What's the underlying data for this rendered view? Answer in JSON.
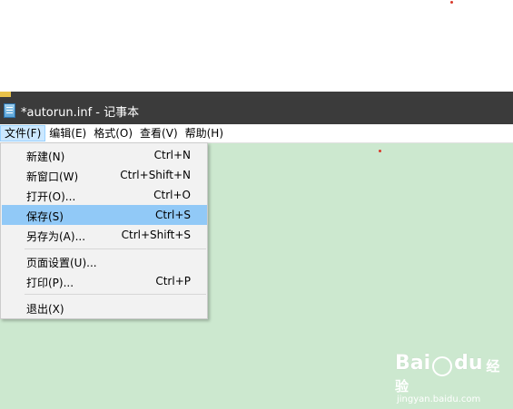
{
  "window": {
    "title": "*autorun.inf - 记事本",
    "icon": "notepad-icon"
  },
  "menubar": [
    {
      "label": "文件(F)",
      "active": true
    },
    {
      "label": "编辑(E)",
      "active": false
    },
    {
      "label": "格式(O)",
      "active": false
    },
    {
      "label": "查看(V)",
      "active": false
    },
    {
      "label": "帮助(H)",
      "active": false
    }
  ],
  "file_menu": {
    "items": [
      {
        "label": "新建(N)",
        "shortcut": "Ctrl+N"
      },
      {
        "label": "新窗口(W)",
        "shortcut": "Ctrl+Shift+N"
      },
      {
        "label": "打开(O)...",
        "shortcut": "Ctrl+O"
      },
      {
        "label": "保存(S)",
        "shortcut": "Ctrl+S",
        "highlighted": true
      },
      {
        "label": "另存为(A)...",
        "shortcut": "Ctrl+Shift+S"
      },
      {
        "label": "页面设置(U)...",
        "shortcut": ""
      },
      {
        "label": "打印(P)...",
        "shortcut": "Ctrl+P"
      },
      {
        "label": "退出(X)",
        "shortcut": ""
      }
    ]
  },
  "watermark": {
    "logo": "Bai",
    "logo_suffix": "du",
    "cn": "经验",
    "url": "jingyan.baidu.com"
  },
  "colors": {
    "titlebar": "#3b3b3b",
    "editor_bg": "#cce8cf",
    "menu_highlight": "#91c9f7",
    "menubar_active": "#cce8ff"
  }
}
